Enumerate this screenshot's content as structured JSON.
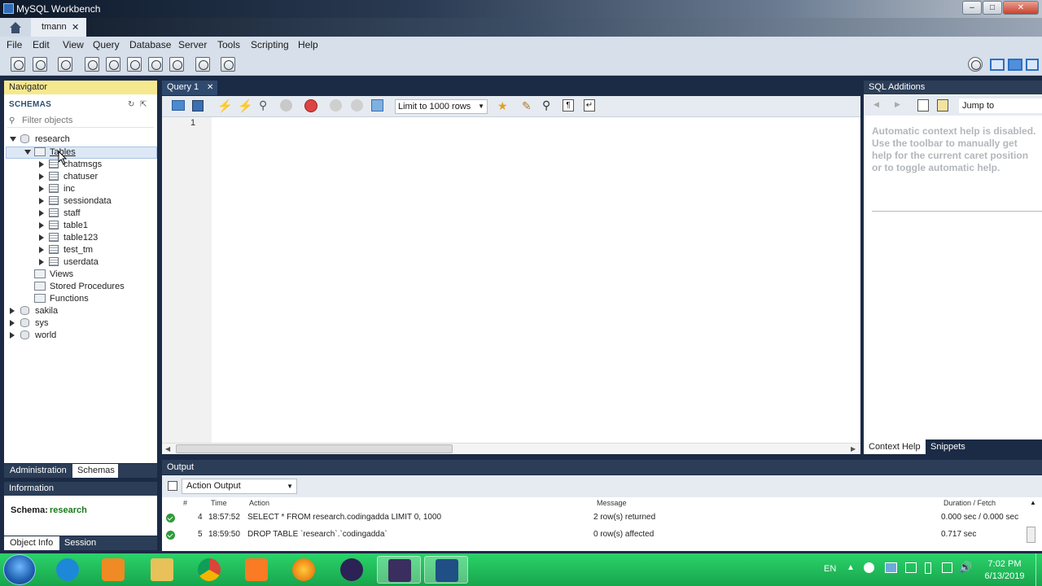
{
  "window": {
    "title": "MySQL Workbench",
    "connection_tab": "tmann"
  },
  "menu": [
    "File",
    "Edit",
    "View",
    "Query",
    "Database",
    "Server",
    "Tools",
    "Scripting",
    "Help"
  ],
  "navigator": {
    "title": "Navigator",
    "schemas_label": "SCHEMAS",
    "filter_placeholder": "Filter objects",
    "tree": {
      "schema": "research",
      "tables_folder": "Tables",
      "tables": [
        "chatmsgs",
        "chatuser",
        "inc",
        "sessiondata",
        "staff",
        "table1",
        "table123",
        "test_tm",
        "userdata"
      ],
      "views": "Views",
      "stored_procedures": "Stored Procedures",
      "functions": "Functions",
      "other_schemas": [
        "sakila",
        "sys",
        "world"
      ]
    },
    "tabs": [
      "Administration",
      "Schemas"
    ]
  },
  "information": {
    "title": "Information",
    "schema_label": "Schema:",
    "schema_value": "research",
    "tabs": [
      "Object Info",
      "Session"
    ]
  },
  "query": {
    "tab_label": "Query 1",
    "limit_label": "Limit to 1000 rows",
    "line_number": "1"
  },
  "sql_additions": {
    "title": "SQL Additions",
    "jump_to": "Jump to",
    "help_lines": [
      "Automatic context help is disabled.",
      "Use the toolbar to manually get",
      "help for the current caret position",
      "or to toggle automatic help."
    ],
    "tabs": [
      "Context Help",
      "Snippets"
    ]
  },
  "output": {
    "title": "Output",
    "selector": "Action Output",
    "columns": [
      "#",
      "Time",
      "Action",
      "Message",
      "Duration / Fetch"
    ],
    "rows": [
      {
        "num": "4",
        "time": "18:57:52",
        "action": "SELECT * FROM research.codingadda LIMIT 0, 1000",
        "message": "2 row(s) returned",
        "duration": "0.000 sec / 0.000 sec"
      },
      {
        "num": "5",
        "time": "18:59:50",
        "action": "DROP TABLE `research`.`codingadda`",
        "message": "0 row(s) affected",
        "duration": "0.717 sec"
      }
    ]
  },
  "taskbar": {
    "language": "EN",
    "time": "7:02 PM",
    "date": "6/13/2019",
    "apps": [
      "internet-explorer",
      "media-player",
      "file-explorer",
      "chrome",
      "xampp",
      "firefox",
      "eclipse",
      "java-ee-ide",
      "mysql-workbench"
    ]
  },
  "colors": {
    "panel_header": "#2c3e57",
    "navigator_header": "#f5e88f",
    "schema_value": "#1a7a1a",
    "taskbar": "#22c25e"
  }
}
